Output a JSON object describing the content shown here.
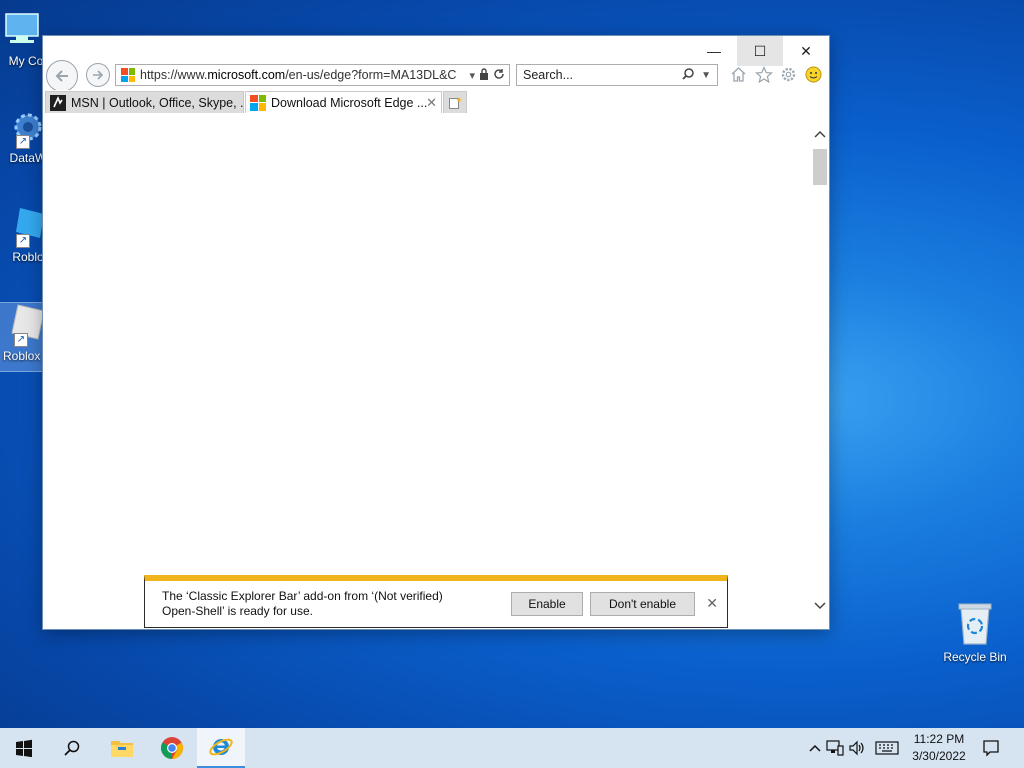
{
  "desktop": {
    "icons": [
      {
        "label": "My Com"
      },
      {
        "label": "DataWa"
      },
      {
        "label": "Roblox"
      },
      {
        "label": "Roblox"
      }
    ],
    "recycle_bin": {
      "label": "Recycle Bin"
    }
  },
  "browser": {
    "window_controls": {
      "minimize": "—",
      "maximize": "☐",
      "close": "✕"
    },
    "address": {
      "url_prefix": "https://www.",
      "url_domain": "microsoft.com",
      "url_path": "/en-us/edge?form=MA13DL&C"
    },
    "search": {
      "placeholder": "Search..."
    },
    "tabs": [
      {
        "label": "MSN | Outlook, Office, Skype, ...",
        "active": false
      },
      {
        "label": "Download Microsoft Edge ...",
        "active": true
      }
    ],
    "notification": {
      "message": "The ‘Classic Explorer Bar’ add-on from ‘(Not verified) Open-Shell’ is ready for use.",
      "enable_label": "Enable",
      "dont_enable_label": "Don't enable",
      "accent_color": "#f0b41c"
    }
  },
  "taskbar": {
    "clock_time": "11:22 PM",
    "clock_date": "3/30/2022",
    "accent": "#3c8ddb"
  }
}
